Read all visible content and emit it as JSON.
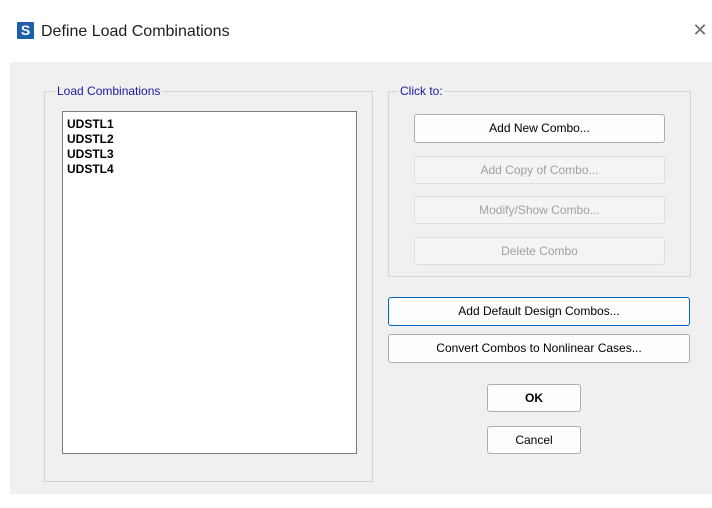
{
  "window": {
    "app_icon_letter": "S",
    "title": "Define Load Combinations",
    "close_glyph": "✕"
  },
  "load_combinations": {
    "label": "Load Combinations",
    "items": [
      "UDSTL1",
      "UDSTL2",
      "UDSTL3",
      "UDSTL4"
    ]
  },
  "click_to": {
    "label": "Click to:",
    "add_new_combo": "Add New Combo...",
    "add_copy_combo": "Add Copy of Combo...",
    "modify_show_combo": "Modify/Show Combo...",
    "delete_combo": "Delete Combo"
  },
  "actions": {
    "add_default_design_combos": "Add Default Design Combos...",
    "convert_combos": "Convert Combos to Nonlinear Cases...",
    "ok": "OK",
    "cancel": "Cancel"
  },
  "colors": {
    "accent": "#0067c0",
    "legend_text": "#1a1aa0",
    "app_icon": "#1f5ea8"
  }
}
